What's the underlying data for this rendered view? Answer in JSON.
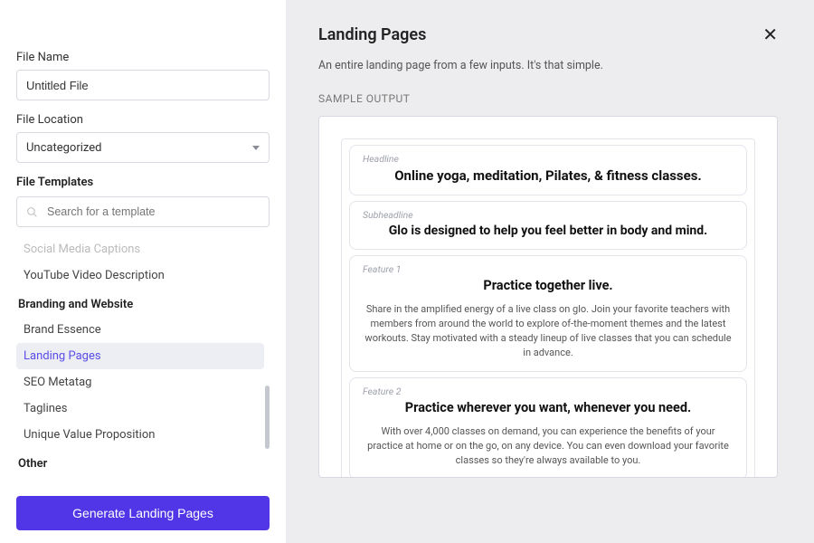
{
  "sidebar": {
    "fileName": {
      "label": "File Name",
      "value": "Untitled File"
    },
    "fileLocation": {
      "label": "File Location",
      "value": "Uncategorized"
    },
    "templates": {
      "label": "File Templates",
      "searchPlaceholder": "Search for a template",
      "visible": [
        {
          "kind": "item",
          "label": "Social Media Captions",
          "faded": true
        },
        {
          "kind": "item",
          "label": "YouTube Video Description"
        },
        {
          "kind": "category",
          "label": "Branding and Website"
        },
        {
          "kind": "item",
          "label": "Brand Essence"
        },
        {
          "kind": "item",
          "label": "Landing Pages",
          "selected": true
        },
        {
          "kind": "item",
          "label": "SEO Metatag"
        },
        {
          "kind": "item",
          "label": "Taglines"
        },
        {
          "kind": "item",
          "label": "Unique Value Proposition"
        },
        {
          "kind": "category",
          "label": "Other"
        }
      ]
    },
    "generateLabel": "Generate Landing Pages"
  },
  "main": {
    "title": "Landing Pages",
    "subtitle": "An entire landing page from a few inputs. It's that simple.",
    "sampleLabel": "SAMPLE OUTPUT",
    "cards": [
      {
        "label": "Headline",
        "title": "Online yoga, meditation, Pilates, & fitness classes.",
        "titleClass": "card-headline"
      },
      {
        "label": "Subheadline",
        "title": "Glo is designed to help you feel better in body and mind.",
        "titleClass": "card-sub"
      },
      {
        "label": "Feature 1",
        "title": "Practice together live.",
        "titleClass": "card-feature-title",
        "body": "Share in the amplified energy of a live class on glo. Join your favorite teachers with members from around the world to explore of-the-moment themes and the latest workouts. Stay motivated with a steady lineup of live classes that you can schedule in advance."
      },
      {
        "label": "Feature 2",
        "title": "Practice wherever you want, whenever you need.",
        "titleClass": "card-feature-title",
        "body": "With over 4,000 classes on demand, you can experience the benefits of your practice at home or on the go, on any device. You can even download your favorite classes so they're always available to you."
      }
    ]
  }
}
